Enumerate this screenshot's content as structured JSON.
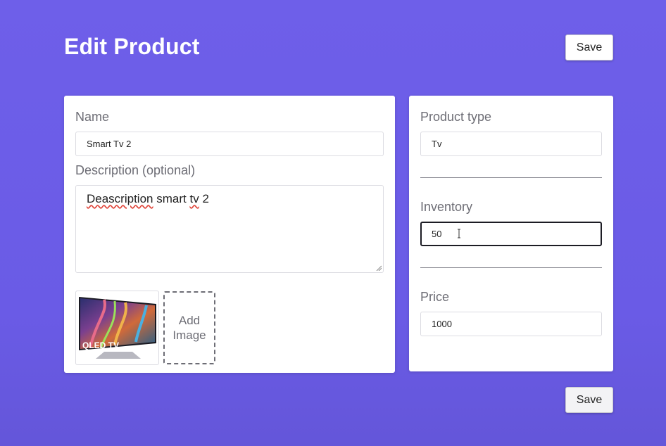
{
  "header": {
    "title": "Edit Product",
    "save_label": "Save"
  },
  "details": {
    "name_label": "Name",
    "name_value": "Smart Tv 2",
    "description_label": "Description (optional)",
    "description_words": [
      "Deascription",
      "smart",
      "tv",
      "2"
    ],
    "add_image_line1": "Add",
    "add_image_line2": "Image",
    "image_text": "QLED TV"
  },
  "organization": {
    "product_type_label": "Product type",
    "product_type_value": "Tv",
    "inventory_label": "Inventory",
    "inventory_value": "50",
    "price_label": "Price",
    "price_value": "1000"
  },
  "footer": {
    "save_label": "Save"
  },
  "colors": {
    "background": "#6e5fe9",
    "card": "#ffffff",
    "label": "#6d6d75",
    "focus_border": "#1c1c24",
    "spellcheck": "#e0453a"
  }
}
